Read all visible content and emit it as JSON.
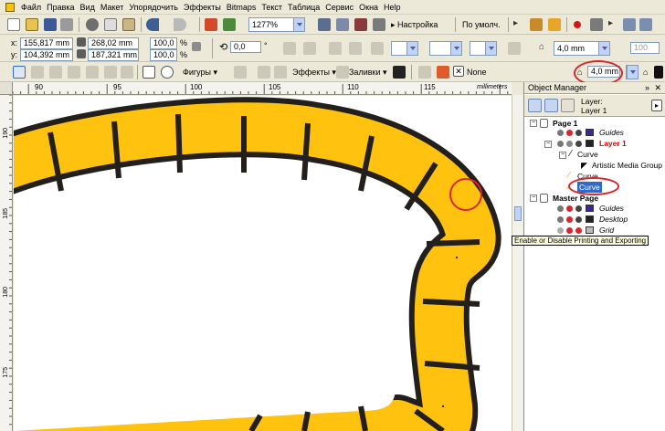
{
  "menu": [
    "Файл",
    "Правка",
    "Вид",
    "Макет",
    "Упорядочить",
    "Эффекты",
    "Bitmaps",
    "Текст",
    "Таблица",
    "Сервис",
    "Окна",
    "Help"
  ],
  "standard_toolbar": {
    "zoom_value": "1277%",
    "settings_label": "Настройка",
    "default_label": "По умолч."
  },
  "property_bar": {
    "x_label": "x:",
    "x_value": "155,817 mm",
    "y_label": "y:",
    "y_value": "104,392 mm",
    "width_value": "268,02 mm",
    "height_value": "187,321 mm",
    "scale_x": "100,0",
    "scale_y": "100,0",
    "percent": "%",
    "angle_value": "0,0",
    "degree": "°",
    "outline_width": "4,0 mm",
    "scale_right": "100"
  },
  "toolbox": {
    "shapes_label": "Фигуры",
    "effects_label": "Эффекты",
    "fills_label": "Заливки",
    "none_label": "None",
    "outline_width": "4,0 mm"
  },
  "ruler": {
    "h_labels": [
      "90",
      "95",
      "100",
      "105",
      "110",
      "115"
    ],
    "units": "millimeters",
    "v_labels": [
      "190",
      "185",
      "180",
      "175"
    ]
  },
  "object_manager": {
    "title": "Object Manager",
    "layer_caption": "Layer:",
    "layer_name": "Layer 1",
    "tree": {
      "page1": "Page 1",
      "guides": "Guides",
      "layer1": "Layer 1",
      "curve1": "Curve",
      "artistic": "Artistic Media Group",
      "curve2": "Curve",
      "curve3": "Curve",
      "master": "Master Page",
      "guides2": "Guides",
      "desktop": "Desktop",
      "grid": "Grid"
    }
  },
  "tooltip": "Enable or Disable Printing and Exporting",
  "colors": {
    "track_fill": "#ffc20e",
    "track_outline": "#231f1c",
    "highlight_circle": "#d8262b",
    "layer_red": "#e00000",
    "selection": "#316ac5"
  }
}
